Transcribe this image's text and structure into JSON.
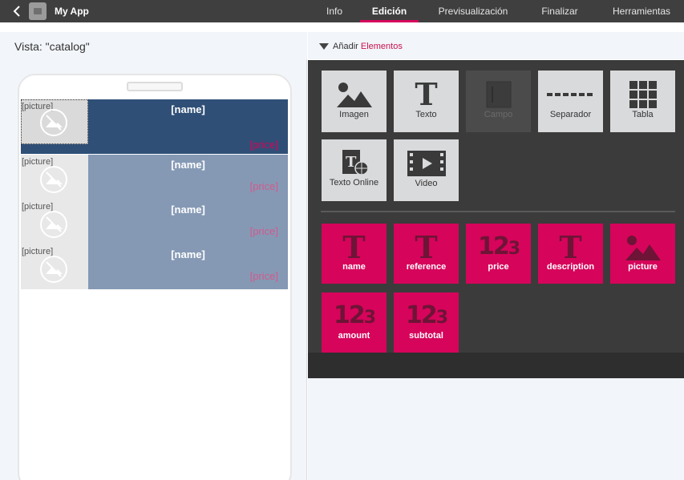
{
  "app": {
    "name": "My App"
  },
  "tabs": [
    {
      "label": "Info",
      "active": false
    },
    {
      "label": "Edición",
      "active": true
    },
    {
      "label": "Previsualización",
      "active": false
    },
    {
      "label": "Finalizar",
      "active": false
    },
    {
      "label": "Herramientas",
      "active": false
    }
  ],
  "view": {
    "label": "Vista: \"catalog\""
  },
  "add": {
    "prefix": "Añadir",
    "link": "Elementos"
  },
  "preview_rows": [
    {
      "picture": "[picture]",
      "name": "[name]",
      "price": "[price]",
      "selected": true
    },
    {
      "picture": "[picture]",
      "name": "[name]",
      "price": "[price]",
      "selected": false
    },
    {
      "picture": "[picture]",
      "name": "[name]",
      "price": "[price]",
      "selected": false
    },
    {
      "picture": "[picture]",
      "name": "[name]",
      "price": "[price]",
      "selected": false
    }
  ],
  "elements": [
    {
      "label": "Imagen",
      "icon": "image-icon",
      "enabled": true
    },
    {
      "label": "Texto",
      "icon": "text-icon",
      "enabled": true
    },
    {
      "label": "Campo",
      "icon": "field-icon",
      "enabled": false
    },
    {
      "label": "Separador",
      "icon": "separator-icon",
      "enabled": true
    },
    {
      "label": "Tabla",
      "icon": "table-icon",
      "enabled": true
    },
    {
      "label": "Texto Online",
      "icon": "online-text-icon",
      "enabled": true
    },
    {
      "label": "Video",
      "icon": "video-icon",
      "enabled": true
    }
  ],
  "fields": [
    {
      "label": "name",
      "icon": "text-icon"
    },
    {
      "label": "reference",
      "icon": "text-icon"
    },
    {
      "label": "price",
      "icon": "number-icon"
    },
    {
      "label": "description",
      "icon": "text-icon"
    },
    {
      "label": "picture",
      "icon": "image-icon"
    },
    {
      "label": "amount",
      "icon": "number-icon"
    },
    {
      "label": "subtotal",
      "icon": "number-icon"
    }
  ],
  "colors": {
    "accent": "#d6045b",
    "topbar": "#3f3f3f",
    "selected_row": "#2f4f77",
    "row": "#8599b5",
    "palette": "#3b3b3b"
  }
}
